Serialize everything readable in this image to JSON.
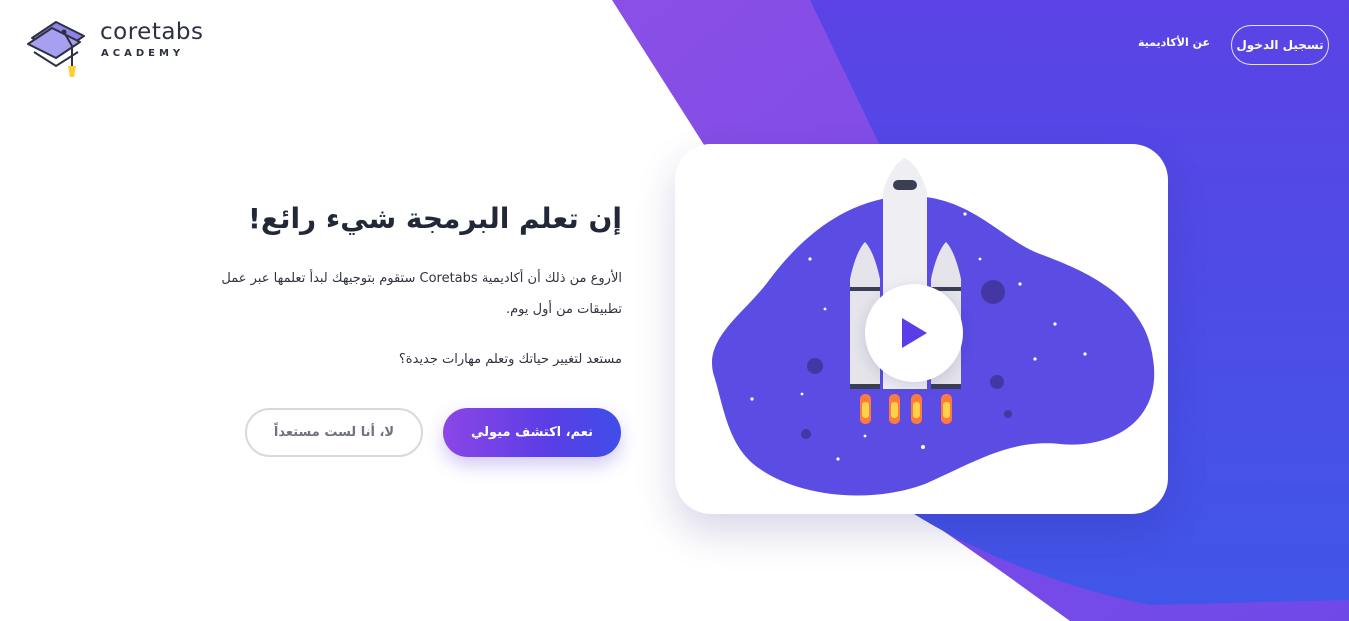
{
  "brand": {
    "name": "coretabs",
    "sub": "ACADEMY"
  },
  "nav": {
    "login": "تسجيل الدخول",
    "about": "عن الأكاديمية"
  },
  "hero": {
    "title": "إن تعلم البرمجة شيء رائع!",
    "description": "الأروع من ذلك أن أكاديمية Coretabs ستقوم بتوجيهك لبدأ تعلمها عبر عمل تطبيقات من أول يوم.",
    "question": "مستعد لتغيير حياتك وتعلم مهارات جديدة؟"
  },
  "buttons": {
    "yes": "نعم، اكتشف ميولي",
    "no": "لا، أنا لست مستعداً"
  },
  "video": {
    "icon": "play-icon",
    "illustration": "rocket-launch"
  },
  "colors": {
    "accent": "#5a3de6",
    "accent_light": "#8b46e6",
    "text": "#222838",
    "blob": "#5b4de3"
  }
}
